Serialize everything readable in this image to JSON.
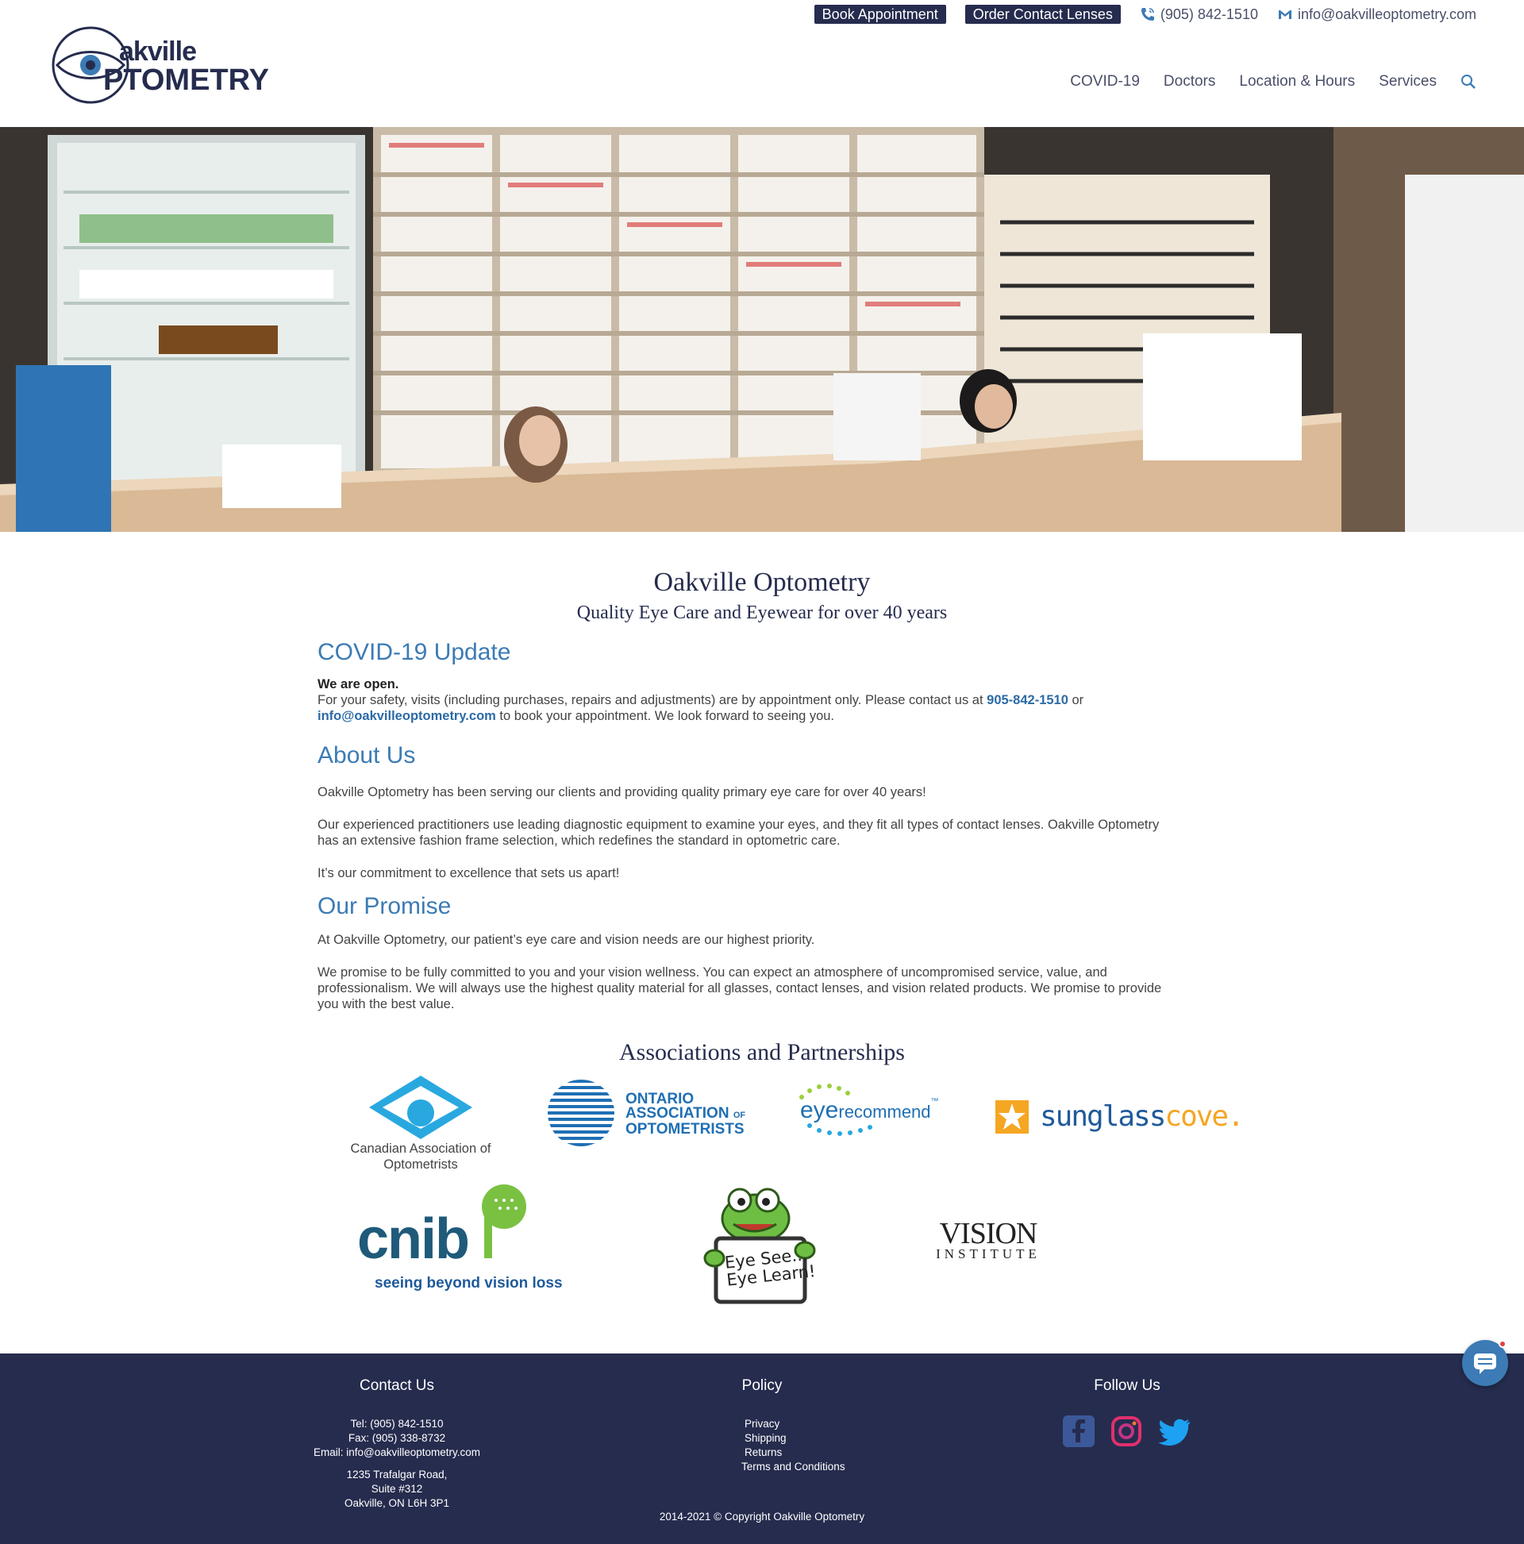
{
  "topbar": {
    "book_label": "Book Appointment",
    "order_label": "Order Contact Lenses",
    "phone": "(905) 842-1510",
    "email": "info@oakvilleoptometry.com"
  },
  "logo": {
    "line1": "akville",
    "line2": "PTOMETRY"
  },
  "nav": {
    "items": [
      "COVID-19",
      "Doctors",
      "Location & Hours",
      "Services"
    ]
  },
  "intro": {
    "title": "Oakville Optometry",
    "subtitle": "Quality Eye Care and Eyewear for over 40 years"
  },
  "covid": {
    "heading": "COVID-19 Update",
    "open": "We are open.",
    "text_a": "For your safety, visits (including purchases, repairs and adjustments) are by appointment only. Please contact us at ",
    "phone_link": "905-842-1510",
    "text_b": " or ",
    "email_link": "info@oakvilleoptometry.com",
    "text_c": " to book your appointment. We look forward to seeing you."
  },
  "about": {
    "heading": "About Us",
    "p1": "Oakville Optometry has been serving our clients and providing quality primary eye care for over 40 years!",
    "p2": "Our experienced practitioners use leading diagnostic equipment to examine your eyes, and they fit all types of contact lenses. Oakville Optometry has an extensive fashion frame selection, which redefines the standard in optometric care.",
    "p3": "It’s our commitment to excellence that sets us apart!"
  },
  "promise": {
    "heading": "Our Promise",
    "p1": "At Oakville Optometry, our patient’s eye care and vision needs are our highest priority.",
    "p2": "We promise to be fully committed to you and your vision wellness. You can expect an atmosphere of uncompromised service, value, and professionalism. We will always use the highest quality material for all glasses, contact lenses, and vision related products. We promise to provide you with the best value."
  },
  "associations": {
    "heading": "Associations and Partnerships",
    "caco_line1": "Canadian Association of",
    "caco_line2": "Optometrists",
    "oao_line1": "ONTARIO",
    "oao_line2": "ASSOCIATION",
    "oao_of": "OF",
    "oao_line3": "OPTOMETRISTS",
    "eye": "eye",
    "recommend": "recommend",
    "tm": "™",
    "sunglass": "sunglass",
    "cove": "cove.",
    "cnib": "cnib",
    "cnib_tag": "seeing beyond vision loss",
    "eyesee_1": "Eye See...",
    "eyesee_2": "Eye Learn!",
    "vision": "VISION",
    "institute": "INSTITUTE"
  },
  "footer": {
    "contact_heading": "Contact Us",
    "tel": "Tel: (905) 842-1510",
    "fax": "Fax: (905) 338-8732",
    "email": "Email:  info@oakvilleoptometry.com",
    "addr1": "1235 Trafalgar Road,",
    "addr2": "Suite #312",
    "addr3": "Oakville, ON L6H 3P1",
    "policy_heading": "Policy",
    "policy_items": [
      "Privacy",
      "Shipping",
      "Returns",
      "Terms and Conditions"
    ],
    "follow_heading": "Follow Us",
    "copyright": "2014-2021 © Copyright Oakville Optometry"
  },
  "colors": {
    "navy": "#262c4e",
    "accent_blue": "#3c7bb5",
    "link_blue": "#2c6aa6"
  }
}
